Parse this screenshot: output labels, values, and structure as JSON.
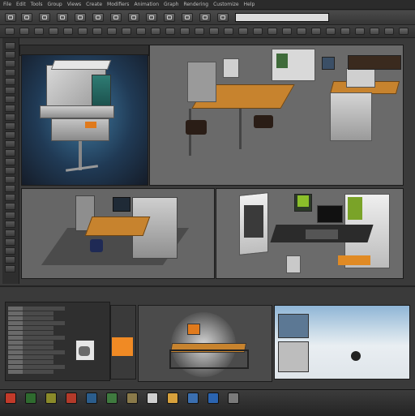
{
  "menu": {
    "items": [
      "File",
      "Edit",
      "Tools",
      "Group",
      "Views",
      "Create",
      "Modifiers",
      "Animation",
      "Graph",
      "Rendering",
      "Customize",
      "Help"
    ]
  },
  "search": {
    "placeholder": ""
  },
  "viewports": {
    "bottom_left_label": "",
    "bottom_right_label": "",
    "top_right_label": ""
  },
  "taskbar": {
    "icons": [
      "close-icon",
      "app-icon-green",
      "app-icon-yellow",
      "app-icon-red",
      "app-icon-blue",
      "app-icon-green-2",
      "app-icon-box",
      "app-icon-doc",
      "app-icon-folder",
      "app-icon-cloud",
      "app-icon-blue-2",
      "app-icon-grey"
    ]
  },
  "colors": {
    "accent_orange": "#f08a24",
    "panel_dark": "#2f2f2f",
    "viewport_grey": "#6a6a6a"
  }
}
